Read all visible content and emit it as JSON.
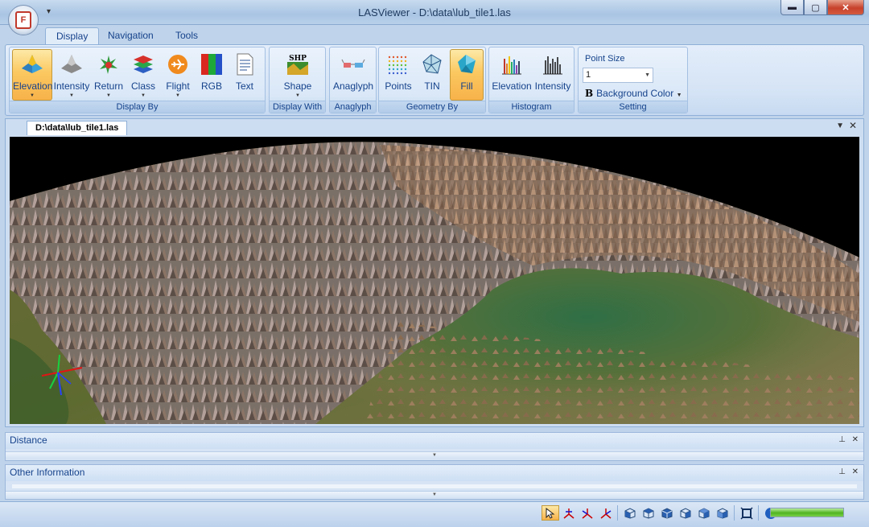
{
  "window": {
    "title": "LASViewer - D:\\data\\lub_tile1.las",
    "app_logo": "F",
    "qa_dropdown": "▾",
    "minimize": "▬",
    "maximize": "▢",
    "close": "✕"
  },
  "ribbon": {
    "tabs": [
      "Display",
      "Navigation",
      "Tools"
    ],
    "active_tab": "Display",
    "groups": {
      "display_by": {
        "label": "Display By",
        "buttons": [
          {
            "label": "Elevation",
            "icon": "elevation-icon",
            "selected": true,
            "dropdown": true
          },
          {
            "label": "Intensity",
            "icon": "intensity-icon",
            "selected": false,
            "dropdown": true
          },
          {
            "label": "Return",
            "icon": "return-icon",
            "selected": false,
            "dropdown": true
          },
          {
            "label": "Class",
            "icon": "class-icon",
            "selected": false,
            "dropdown": true
          },
          {
            "label": "Flight",
            "icon": "flight-icon",
            "selected": false,
            "dropdown": true
          },
          {
            "label": "RGB",
            "icon": "rgb-icon",
            "selected": false,
            "dropdown": false
          },
          {
            "label": "Text",
            "icon": "text-icon",
            "selected": false,
            "dropdown": false
          }
        ]
      },
      "display_with": {
        "label": "Display With",
        "button": {
          "label": "Shape",
          "icon_text": "SHP",
          "dropdown": true
        }
      },
      "anaglyph": {
        "label": "Anaglyph",
        "button": {
          "label": "Anaglyph",
          "icon": "anaglyph-glasses-icon"
        }
      },
      "geometry_by": {
        "label": "Geometry By",
        "buttons": [
          {
            "label": "Points",
            "icon": "points-icon",
            "selected": false
          },
          {
            "label": "TIN",
            "icon": "tin-icon",
            "selected": false
          },
          {
            "label": "Fill",
            "icon": "fill-icon",
            "selected": true
          }
        ]
      },
      "histogram": {
        "label": "Histogram",
        "buttons": [
          {
            "label": "Elevation",
            "icon": "elevation-histogram-icon"
          },
          {
            "label": "Intensity",
            "icon": "intensity-histogram-icon"
          }
        ]
      },
      "setting": {
        "label": "Setting",
        "point_size_label": "Point Size",
        "point_size_value": "1",
        "background_color_label": "Background Color",
        "bold_glyph": "B"
      }
    }
  },
  "document": {
    "tab_label": "D:\\data\\lub_tile1.las",
    "viewport": {
      "scene": "3d-point-cloud-tin-fill",
      "background": "#000000"
    }
  },
  "panels": {
    "distance": {
      "title": "Distance"
    },
    "other_info": {
      "title": "Other Information"
    }
  },
  "statusbar": {
    "tools": [
      "select-arrow-icon",
      "axis-xyz-icon",
      "axis-xy-icon",
      "axis-z-icon",
      "view-front-icon",
      "view-back-icon",
      "view-left-icon",
      "view-right-icon",
      "view-top-icon",
      "view-bottom-icon",
      "fit-extent-icon",
      "info-icon"
    ],
    "progress": 1.0
  },
  "colors": {
    "accent": "#15428b",
    "selected": "#f8b24a",
    "progress": "#4fb41f"
  }
}
